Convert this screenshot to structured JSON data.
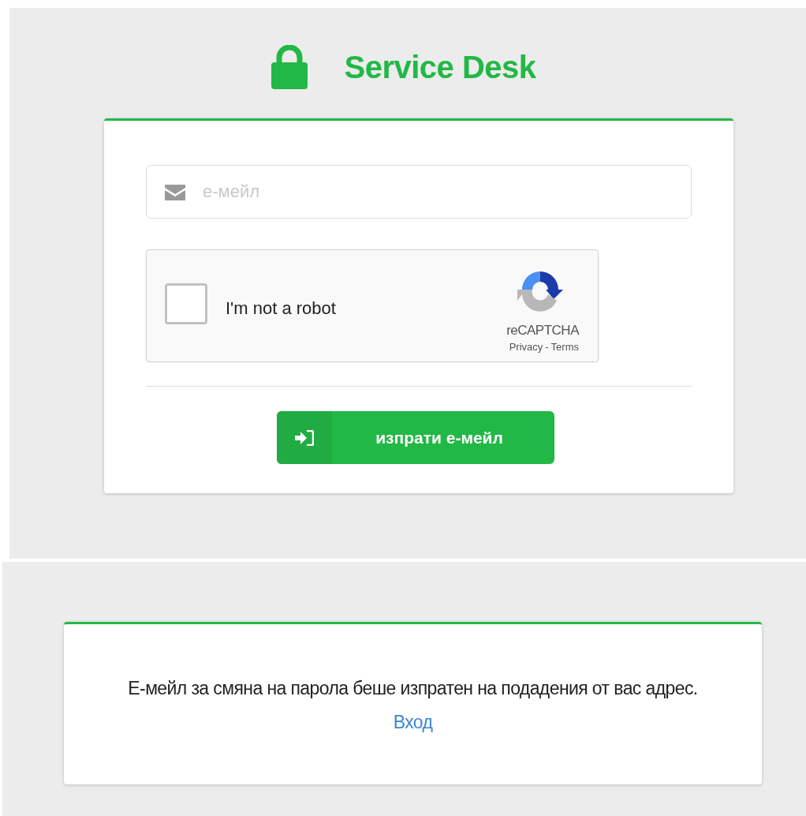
{
  "header": {
    "title": "Service Desk"
  },
  "form": {
    "email": {
      "placeholder": "е-мейл"
    },
    "captcha": {
      "label": "I'm not a robot",
      "checked": false,
      "brand": "reCAPTCHA",
      "privacy": "Privacy",
      "separator": "-",
      "terms": "Terms"
    },
    "submit": "изпрати е-мейл"
  },
  "message": {
    "text": "Е-мейл за смяна на парола беше изпратен на подадения от вас адрес.",
    "link": "Вход"
  }
}
